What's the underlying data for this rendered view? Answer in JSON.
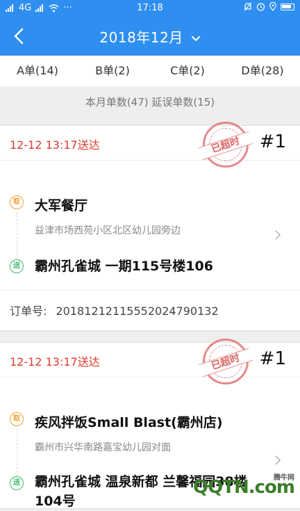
{
  "status_bar": {
    "left_text": "4G",
    "time": "17:18"
  },
  "header": {
    "title": "2018年12月"
  },
  "tabs": [
    {
      "label": "A单(14)"
    },
    {
      "label": "B单(2)"
    },
    {
      "label": "C单(2)"
    },
    {
      "label": "D单(28)"
    }
  ],
  "summary": "本月单数(47) 延误单数(15)",
  "orders": [
    {
      "deliver_time": "12-12 13:17送达",
      "stamp": "已超时",
      "number": "#1",
      "pickup_badge": "取",
      "pickup_name": "大军餐厅",
      "pickup_address": "益津市场西苑小区北区幼儿园旁边",
      "dropoff_badge": "送",
      "dropoff_address": "霸州孔雀城 一期115号楼106",
      "order_label": "订单号:",
      "order_id": "20181212115552024790132"
    },
    {
      "deliver_time": "12-12 13:17送达",
      "stamp": "已超时",
      "number": "#1",
      "pickup_badge": "取",
      "pickup_name": "疾风拌饭Small Blast(霸州店)",
      "pickup_address": "霸州市兴华南路嘉宝幼儿园对面",
      "dropoff_badge": "送",
      "dropoff_address": "霸州孔雀城 温泉新都 兰馨福园38楼104号"
    }
  ],
  "watermark": {
    "small": "腾牛网",
    "large": "QQTN.com"
  },
  "colors": {
    "primary": "#2f8ff0",
    "overdue": "#e03a2f",
    "pickup": "#f0a030",
    "dropoff": "#3bb86a"
  }
}
